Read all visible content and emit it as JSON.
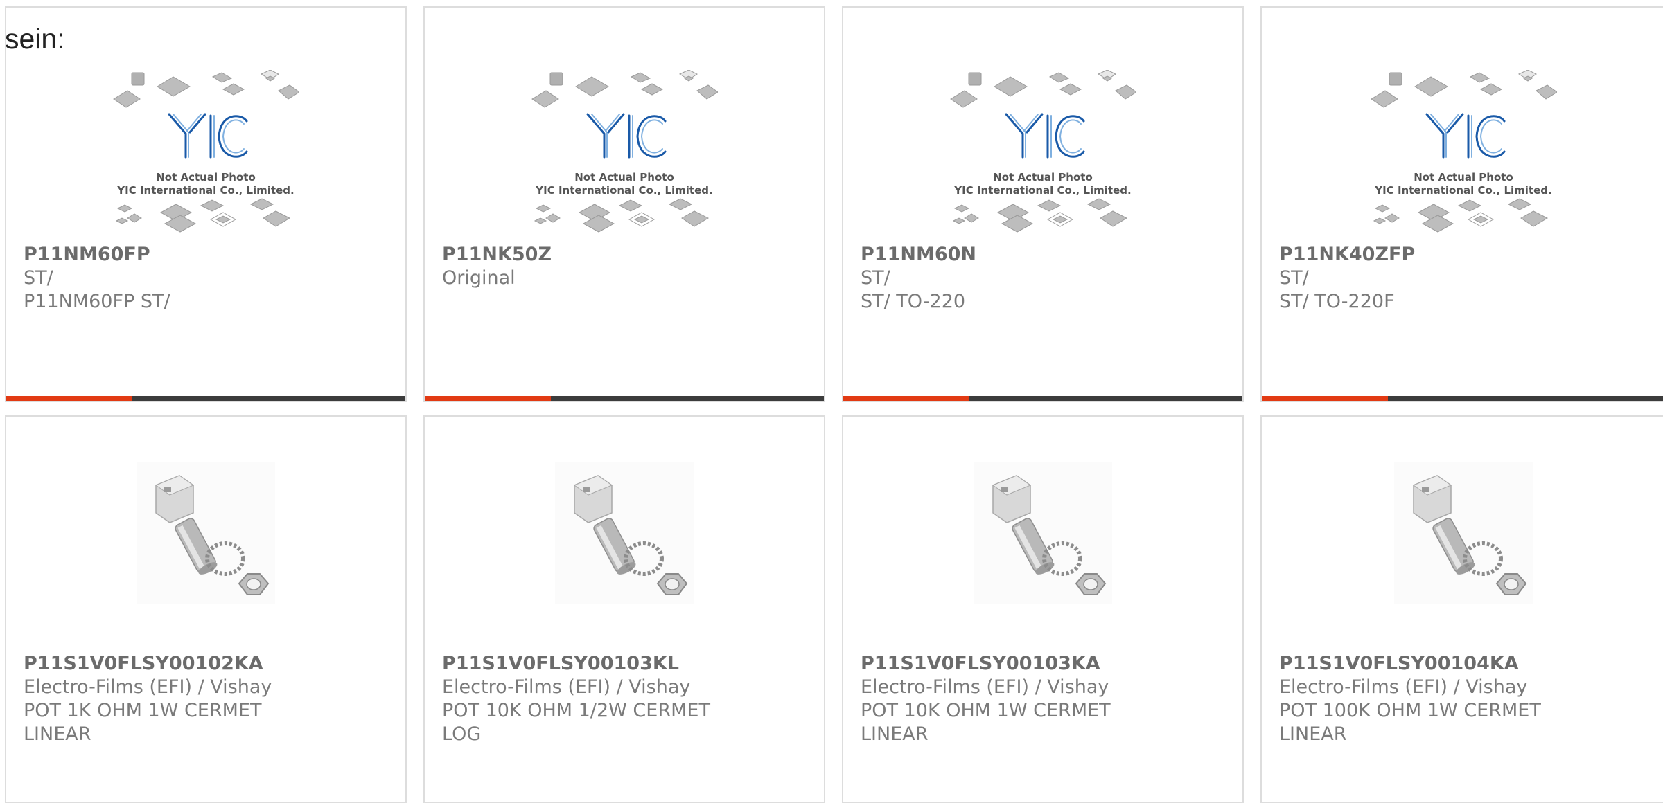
{
  "lead_text": "sein:",
  "placeholder": {
    "caption_line1": "Not Actual Photo",
    "caption_line2": "YIC International Co., Limited."
  },
  "colors": {
    "accent": "#e23a13",
    "bar_dark": "#3c3c3c",
    "card_border": "#dddddd",
    "text": "#6b6b6b",
    "logo_blue": "#1a5aa8"
  },
  "products": [
    {
      "part": "P11NM60FP",
      "line1": "ST/",
      "line2": "P11NM60FP ST/",
      "line3": "",
      "image": "not-actual-photo-placeholder"
    },
    {
      "part": "P11NK50Z",
      "line1": "Original",
      "line2": "",
      "line3": "",
      "image": "not-actual-photo-placeholder"
    },
    {
      "part": "P11NM60N",
      "line1": "ST/",
      "line2": "ST/ TO-220",
      "line3": "",
      "image": "not-actual-photo-placeholder"
    },
    {
      "part": "P11NK40ZFP",
      "line1": "ST/",
      "line2": "ST/ TO-220F",
      "line3": "",
      "image": "not-actual-photo-placeholder"
    },
    {
      "part": "P11S1V0FLSY00102KA",
      "line1": "Electro-Films (EFI) / Vishay",
      "line2": "POT 1K OHM 1W CERMET",
      "line3": "LINEAR",
      "image": "potentiometer-photo"
    },
    {
      "part": "P11S1V0FLSY00103KL",
      "line1": "Electro-Films (EFI) / Vishay",
      "line2": "POT 10K OHM 1/2W CERMET",
      "line3": "LOG",
      "image": "potentiometer-photo"
    },
    {
      "part": "P11S1V0FLSY00103KA",
      "line1": "Electro-Films (EFI) / Vishay",
      "line2": "POT 10K OHM 1W CERMET",
      "line3": "LINEAR",
      "image": "potentiometer-photo"
    },
    {
      "part": "P11S1V0FLSY00104KA",
      "line1": "Electro-Films (EFI) / Vishay",
      "line2": "POT 100K OHM 1W CERMET",
      "line3": "LINEAR",
      "image": "potentiometer-photo"
    }
  ]
}
